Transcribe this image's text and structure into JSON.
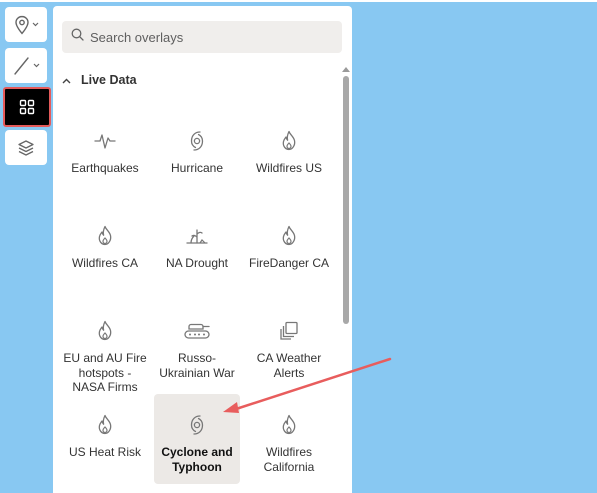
{
  "colors": {
    "map_background": "#88c8f2",
    "highlight_border": "#e55a5a",
    "annotation_arrow": "#e85d5d",
    "selected_tile": "#ece9e6"
  },
  "toolbar": {
    "buttons": [
      {
        "icon": "map-marker-icon",
        "has_dropdown": true
      },
      {
        "icon": "line-tool-icon",
        "has_dropdown": true
      },
      {
        "icon": "grid-overlays-icon",
        "active": true
      },
      {
        "icon": "layers-icon"
      }
    ]
  },
  "search": {
    "placeholder": "Search overlays"
  },
  "section": {
    "label": "Live Data",
    "expanded": true
  },
  "overlays": [
    {
      "label": "Earthquakes",
      "icon": "seismograph-icon"
    },
    {
      "label": "Hurricane",
      "icon": "hurricane-icon"
    },
    {
      "label": "Wildfires US",
      "icon": "flame-icon"
    },
    {
      "label": "Wildfires CA",
      "icon": "flame-icon"
    },
    {
      "label": "NA Drought",
      "icon": "drought-icon"
    },
    {
      "label": "FireDanger CA",
      "icon": "flame-icon"
    },
    {
      "label": "EU and AU Fire hotspots - NASA Firms",
      "icon": "flame-icon"
    },
    {
      "label": "Russo-Ukrainian War",
      "icon": "tank-icon"
    },
    {
      "label": "CA Weather Alerts",
      "icon": "stacked-squares-icon"
    },
    {
      "label": "US Heat Risk",
      "icon": "flame-icon"
    },
    {
      "label": "Cyclone and Typhoon",
      "icon": "hurricane-icon",
      "selected": true
    },
    {
      "label": "Wildfires California",
      "icon": "flame-icon"
    }
  ]
}
